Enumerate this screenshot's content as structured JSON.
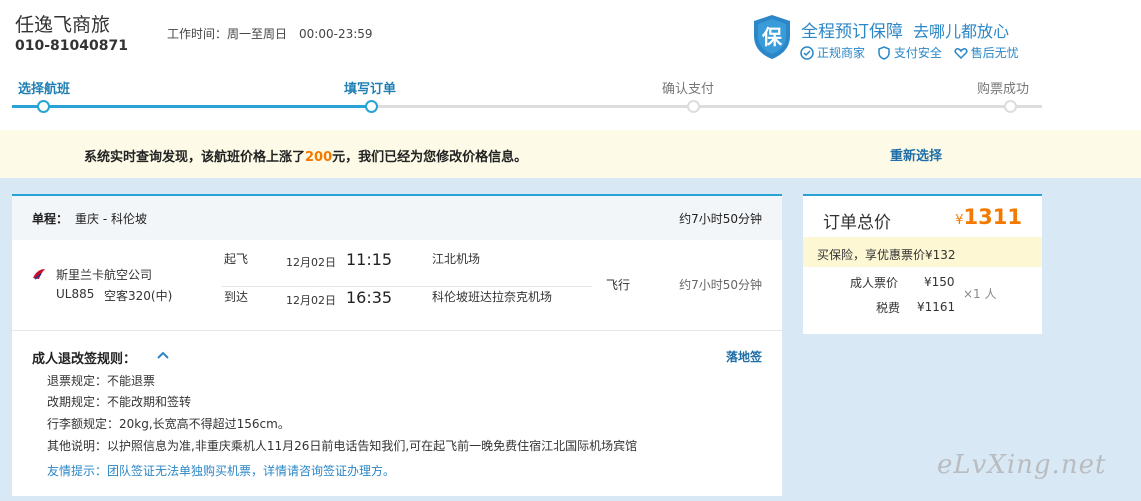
{
  "header": {
    "brand_name": "任逸飞商旅",
    "phone": "010-81040871",
    "work_hours_label": "工作时间：",
    "work_days": "周一至周日",
    "work_time": "00:00-23:59"
  },
  "guarantee": {
    "badge": "保",
    "title": "全程预订保障",
    "slogan": "去哪儿都放心",
    "items": [
      "正规商家",
      "支付安全",
      "售后无忧"
    ]
  },
  "steps": [
    "选择航班",
    "填写订单",
    "确认支付",
    "购票成功"
  ],
  "notice": {
    "text_before": "系统实时查询发现，该航班价格上涨了",
    "rise": "200",
    "text_after": "元，我们已经为您修改价格信息。",
    "reselect": "重新选择"
  },
  "flight": {
    "route_label": "单程：",
    "route": "重庆 - 科伦坡",
    "duration": "约7小时50分钟",
    "airline": "斯里兰卡航空公司",
    "flight_no": "UL885",
    "aircraft": "空客320(中)",
    "depart_label": "起飞",
    "depart_date": "12月02日",
    "depart_time": "11:15",
    "depart_airport": "江北机场",
    "arrive_label": "到达",
    "arrive_date": "12月02日",
    "arrive_time": "16:35",
    "arrive_airport": "科伦坡班达拉奈克机场",
    "fly_label": "飞行",
    "fly_duration": "约7小时50分钟"
  },
  "rules": {
    "title": "成人退改签规则：",
    "visa_link": "落地签",
    "refund": "退票规定：不能退票",
    "change": "改期规定：不能改期和签转",
    "baggage": "行李额规定：20kg,长宽高不得超过156cm。",
    "other": "其他说明：以护照信息为准,非重庆乘机人11月26日前电话告知我们,可在起飞前一晚免费住宿江北国际机场宾馆",
    "tip": "友情提示：团队签证无法单独购买机票，详情请咨询签证办理方。"
  },
  "order": {
    "title": "订单总价",
    "currency": "¥",
    "total": "1311",
    "insurance": "买保险，享优惠票价¥132",
    "adult_fare_label": "成人票价",
    "adult_fare": "¥150",
    "tax_label": "税费",
    "tax": "¥1161",
    "multiplier": "×1 人"
  },
  "watermark": "eLvXing.net",
  "colors": {
    "accent": "#29a3d6",
    "link": "#1f6ea8",
    "price": "#f37900",
    "notice_bg": "#fdfbe7",
    "area_bg": "#d9e8f5"
  }
}
